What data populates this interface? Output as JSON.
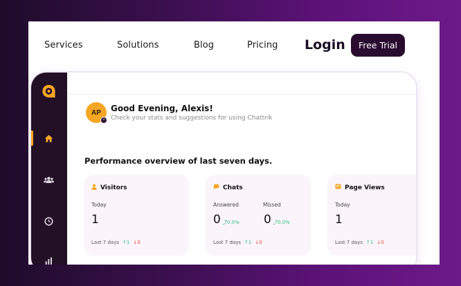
{
  "nav": {
    "links": [
      "Services",
      "Solutions",
      "Blog",
      "Pricing"
    ],
    "login_label": "Login",
    "cta_label": "Free Trial"
  },
  "sidebar": {
    "logo_icon": "chattrik-logo-icon",
    "items": [
      {
        "icon": "home-icon",
        "active": true
      },
      {
        "icon": "users-icon",
        "active": false
      },
      {
        "icon": "clock-icon",
        "active": false
      },
      {
        "icon": "bar-chart-icon",
        "active": false
      }
    ],
    "accent_color": "#f5a623"
  },
  "user": {
    "initials": "AP",
    "greeting": "Good Evening, Alexis!",
    "subtitle": "Check your stats and suggestions for using Chattrik"
  },
  "overview": {
    "title": "Performance overview of last seven days.",
    "cards": [
      {
        "title": "Visitors",
        "icon": "user-icon",
        "metrics": [
          {
            "label": "Today",
            "value": "1"
          }
        ],
        "footer": {
          "label": "Last 7 days",
          "up": "1",
          "down": "0"
        }
      },
      {
        "title": "Chats",
        "icon": "chat-icon",
        "metrics": [
          {
            "label": "Answered",
            "value": "0",
            "change": "0.0%"
          },
          {
            "label": "Missed",
            "value": "0",
            "change": "0.0%"
          }
        ],
        "footer": {
          "label": "Last 7 days",
          "up": "1",
          "down": "0"
        }
      },
      {
        "title": "Page Views",
        "icon": "page-icon",
        "metrics": [
          {
            "label": "Today",
            "value": "1"
          }
        ],
        "footer": {
          "label": "Last 7 days",
          "up": "1",
          "down": "0"
        }
      }
    ]
  }
}
